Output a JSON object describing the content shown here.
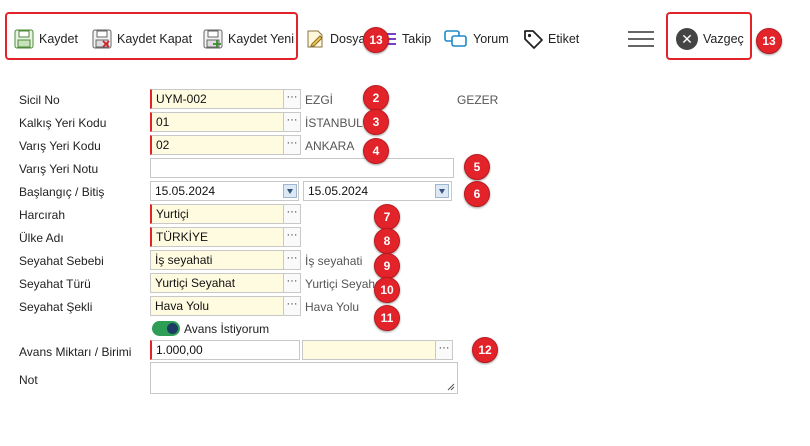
{
  "toolbar": {
    "save_label": "Kaydet",
    "save_close_label": "Kaydet Kapat",
    "save_new_label": "Kaydet Yeni",
    "file_label": "Dosya",
    "follow_label": "Takip",
    "comment_label": "Yorum",
    "tag_label": "Etiket",
    "cancel_label": "Vazgeç"
  },
  "badges": [
    "13",
    "2",
    "3",
    "4",
    "5",
    "6",
    "7",
    "8",
    "9",
    "10",
    "11",
    "12",
    "13"
  ],
  "form": {
    "sicil_no": {
      "label": "Sicil No",
      "value": "UYM-002",
      "first_name": "EZGİ",
      "last_name": "GEZER"
    },
    "kalkis": {
      "label": "Kalkış Yeri Kodu",
      "value": "01",
      "desc": "İSTANBUL"
    },
    "varis": {
      "label": "Varış Yeri Kodu",
      "value": "02",
      "desc": "ANKARA"
    },
    "varis_notu": {
      "label": "Varış Yeri Notu",
      "value": ""
    },
    "tarih": {
      "label": "Başlangıç / Bitiş",
      "start": "15.05.2024",
      "end": "15.05.2024"
    },
    "harcirah": {
      "label": "Harcırah",
      "value": "Yurtiçi"
    },
    "ulke": {
      "label": "Ülke Adı",
      "value": "TÜRKİYE"
    },
    "sebep": {
      "label": "Seyahat Sebebi",
      "value": "İş seyahati",
      "desc": "İş seyahati"
    },
    "tur": {
      "label": "Seyahat Türü",
      "value": "Yurtiçi Seyahat",
      "desc": "Yurtiçi Seyahat"
    },
    "sekil": {
      "label": "Seyahat Şekli",
      "value": "Hava Yolu",
      "desc": "Hava Yolu"
    },
    "avans_toggle": {
      "label": "Avans İstiyorum"
    },
    "avans": {
      "label": "Avans Miktarı / Birimi",
      "amount": "1.000,00",
      "currency": ""
    },
    "not": {
      "label": "Not",
      "value": ""
    }
  },
  "colors": {
    "accent_red": "#e3232a",
    "field_yellow": "#fffbe0",
    "toggle_green": "#2e9d55"
  }
}
